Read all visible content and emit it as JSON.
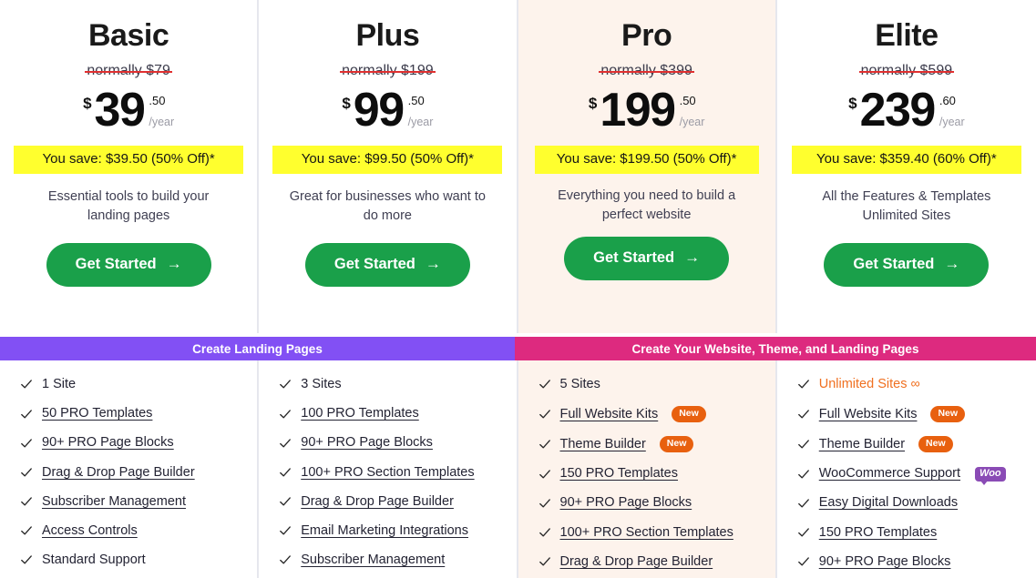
{
  "banners": {
    "landing": {
      "label": "Create Landing Pages",
      "color": "#8250f4"
    },
    "website": {
      "label": "Create Your Website, Theme, and Landing Pages",
      "color": "#dd2a7f"
    }
  },
  "common": {
    "currency_symbol": "$",
    "period": "/year",
    "cta_label": "Get Started",
    "cta_arrow": "→",
    "check_icon": "check-icon",
    "new_badge_label": "New",
    "woo_badge_label": "Woo",
    "cta_color": "#1aa04a",
    "save_badge_color": "#ffff2e",
    "featured_background": "#fdf3ec"
  },
  "plans": [
    {
      "name": "Basic",
      "normally": "normally $79",
      "price_whole": "39",
      "price_cents": ".50",
      "save_text": "You save: $39.50 (50% Off)*",
      "description": "Essential tools to build your landing pages",
      "featured": false,
      "features": [
        {
          "label": "1 Site",
          "linked": false,
          "badge": null,
          "accent": false
        },
        {
          "label": "50 PRO Templates",
          "linked": true,
          "badge": null,
          "accent": false
        },
        {
          "label": "90+ PRO Page Blocks",
          "linked": true,
          "badge": null,
          "accent": false
        },
        {
          "label": "Drag & Drop Page Builder",
          "linked": true,
          "badge": null,
          "accent": false
        },
        {
          "label": "Subscriber Management",
          "linked": true,
          "badge": null,
          "accent": false
        },
        {
          "label": "Access Controls",
          "linked": true,
          "badge": null,
          "accent": false
        },
        {
          "label": "Standard Support",
          "linked": false,
          "badge": null,
          "accent": false
        }
      ]
    },
    {
      "name": "Plus",
      "normally": "normally $199",
      "price_whole": "99",
      "price_cents": ".50",
      "save_text": "You save: $99.50 (50% Off)*",
      "description": "Great for businesses who want to do more",
      "featured": false,
      "features": [
        {
          "label": "3 Sites",
          "linked": false,
          "badge": null,
          "accent": false
        },
        {
          "label": "100 PRO Templates",
          "linked": true,
          "badge": null,
          "accent": false
        },
        {
          "label": "90+ PRO Page Blocks",
          "linked": true,
          "badge": null,
          "accent": false
        },
        {
          "label": "100+ PRO Section Templates",
          "linked": true,
          "badge": null,
          "accent": false
        },
        {
          "label": "Drag & Drop Page Builder",
          "linked": true,
          "badge": null,
          "accent": false
        },
        {
          "label": "Email Marketing Integrations",
          "linked": true,
          "badge": null,
          "accent": false
        },
        {
          "label": "Subscriber Management",
          "linked": true,
          "badge": null,
          "accent": false
        }
      ]
    },
    {
      "name": "Pro",
      "normally": "normally $399",
      "price_whole": "199",
      "price_cents": ".50",
      "save_text": "You save: $199.50 (50% Off)*",
      "description": "Everything you need to build a perfect website",
      "featured": true,
      "features": [
        {
          "label": "5 Sites",
          "linked": false,
          "badge": null,
          "accent": false
        },
        {
          "label": "Full Website Kits",
          "linked": true,
          "badge": "New",
          "accent": false
        },
        {
          "label": "Theme Builder",
          "linked": true,
          "badge": "New",
          "accent": false
        },
        {
          "label": "150 PRO Templates",
          "linked": true,
          "badge": null,
          "accent": false
        },
        {
          "label": "90+ PRO Page Blocks",
          "linked": true,
          "badge": null,
          "accent": false
        },
        {
          "label": "100+ PRO Section Templates",
          "linked": true,
          "badge": null,
          "accent": false
        },
        {
          "label": "Drag & Drop Page Builder",
          "linked": true,
          "badge": null,
          "accent": false
        }
      ]
    },
    {
      "name": "Elite",
      "normally": "normally $599",
      "price_whole": "239",
      "price_cents": ".60",
      "save_text": "You save: $359.40 (60% Off)*",
      "description": "All the Features & Templates Unlimited Sites",
      "featured": false,
      "features": [
        {
          "label": "Unlimited Sites ∞",
          "linked": false,
          "badge": null,
          "accent": true
        },
        {
          "label": "Full Website Kits",
          "linked": true,
          "badge": "New",
          "accent": false
        },
        {
          "label": "Theme Builder",
          "linked": true,
          "badge": "New",
          "accent": false
        },
        {
          "label": "WooCommerce Support",
          "linked": true,
          "badge": "Woo",
          "accent": false
        },
        {
          "label": "Easy Digital Downloads",
          "linked": true,
          "badge": null,
          "accent": false
        },
        {
          "label": "150 PRO Templates",
          "linked": true,
          "badge": null,
          "accent": false
        },
        {
          "label": "90+ PRO Page Blocks",
          "linked": true,
          "badge": null,
          "accent": false
        }
      ]
    }
  ]
}
